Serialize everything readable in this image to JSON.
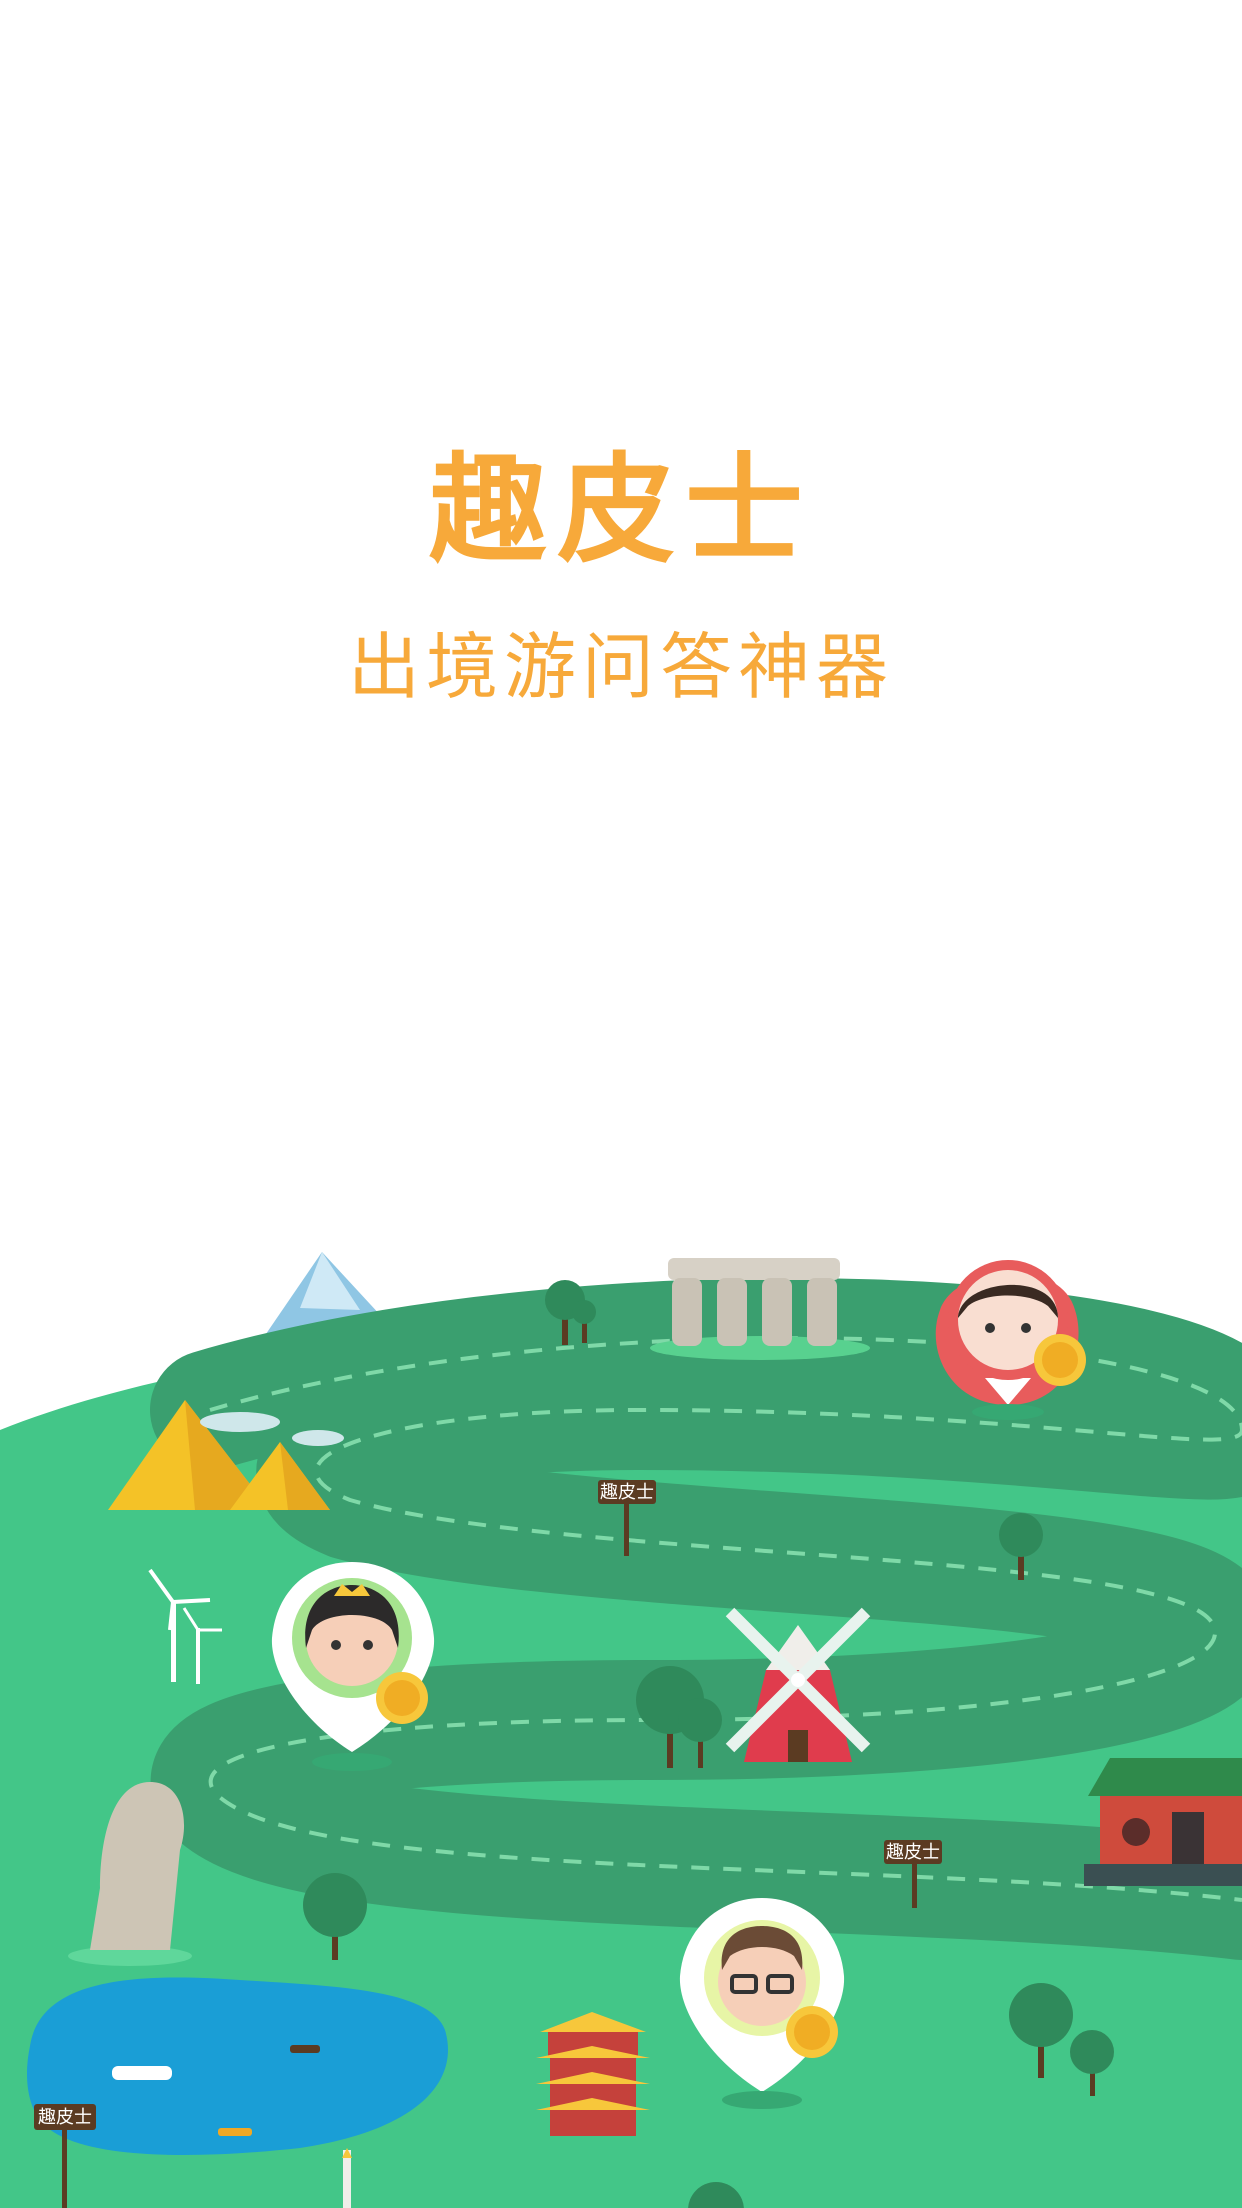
{
  "app": {
    "name": "趣皮士",
    "tagline": "出境游问答神器"
  },
  "scene": {
    "signposts": [
      {
        "label": "趣皮士"
      },
      {
        "label": "趣皮士"
      },
      {
        "label": "趣皮士"
      }
    ],
    "avatars": [
      {
        "name": "girl-avatar-pin"
      },
      {
        "name": "woman-avatar-pin"
      },
      {
        "name": "boy-avatar-pin"
      }
    ]
  },
  "colors": {
    "brand": "#f7a93a",
    "grass": "#43c688",
    "path": "#3a9f6f",
    "water": "#1a9ed6"
  }
}
